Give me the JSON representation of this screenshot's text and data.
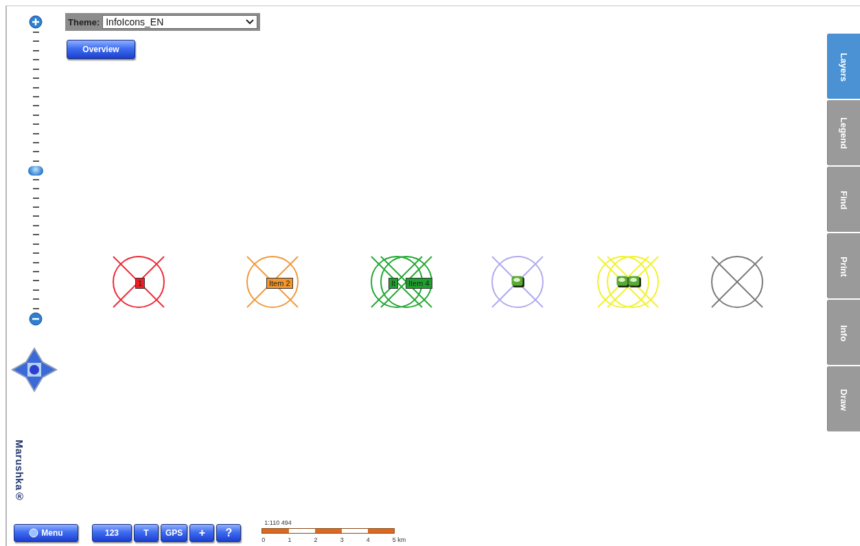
{
  "theme_select": {
    "label": "Theme:",
    "value": "InfoIcons_EN"
  },
  "overview_button": "Overview",
  "zoom_slider": {
    "level": 0.5
  },
  "brand": "Marushka®",
  "markers": [
    {
      "color": "#ee2a36",
      "symbols": [
        {
          "kind": "label",
          "text": "1",
          "color": "#ee1c24"
        }
      ]
    },
    {
      "color": "#f09a3c",
      "symbols": [
        {
          "kind": "label",
          "text": "Item 2",
          "color": "#f0962c"
        }
      ]
    },
    {
      "color": "#22a832",
      "symbols": [
        {
          "kind": "label",
          "text": "It",
          "color": "#1ea02c"
        },
        {
          "kind": "label",
          "text": "Item 4",
          "color": "#1ea02c"
        }
      ]
    },
    {
      "color": "#b0aaee",
      "symbols": [
        {
          "kind": "icon"
        }
      ]
    },
    {
      "color": "#f2f22a",
      "symbols": [
        {
          "kind": "icon"
        },
        {
          "kind": "icon"
        }
      ]
    },
    {
      "color": "#7a7a7a"
    }
  ],
  "side_tabs": [
    {
      "label": "Layers",
      "selected": true
    },
    {
      "label": "Legend",
      "selected": false
    },
    {
      "label": "Find",
      "selected": false
    },
    {
      "label": "Print",
      "selected": false
    },
    {
      "label": "Info",
      "selected": false
    },
    {
      "label": "Draw",
      "selected": false
    }
  ],
  "toolbar": {
    "menu": "Menu",
    "buttons": [
      {
        "kind": "text",
        "label": "123"
      },
      {
        "kind": "text",
        "label": "T"
      },
      {
        "kind": "text",
        "label": "GPS"
      },
      {
        "kind": "text",
        "label": "+"
      },
      {
        "kind": "text",
        "label": "?"
      }
    ]
  },
  "scale": {
    "ratio": "1:110 494",
    "ticks": [
      "0",
      "1",
      "2",
      "3",
      "4",
      "5 km"
    ]
  }
}
